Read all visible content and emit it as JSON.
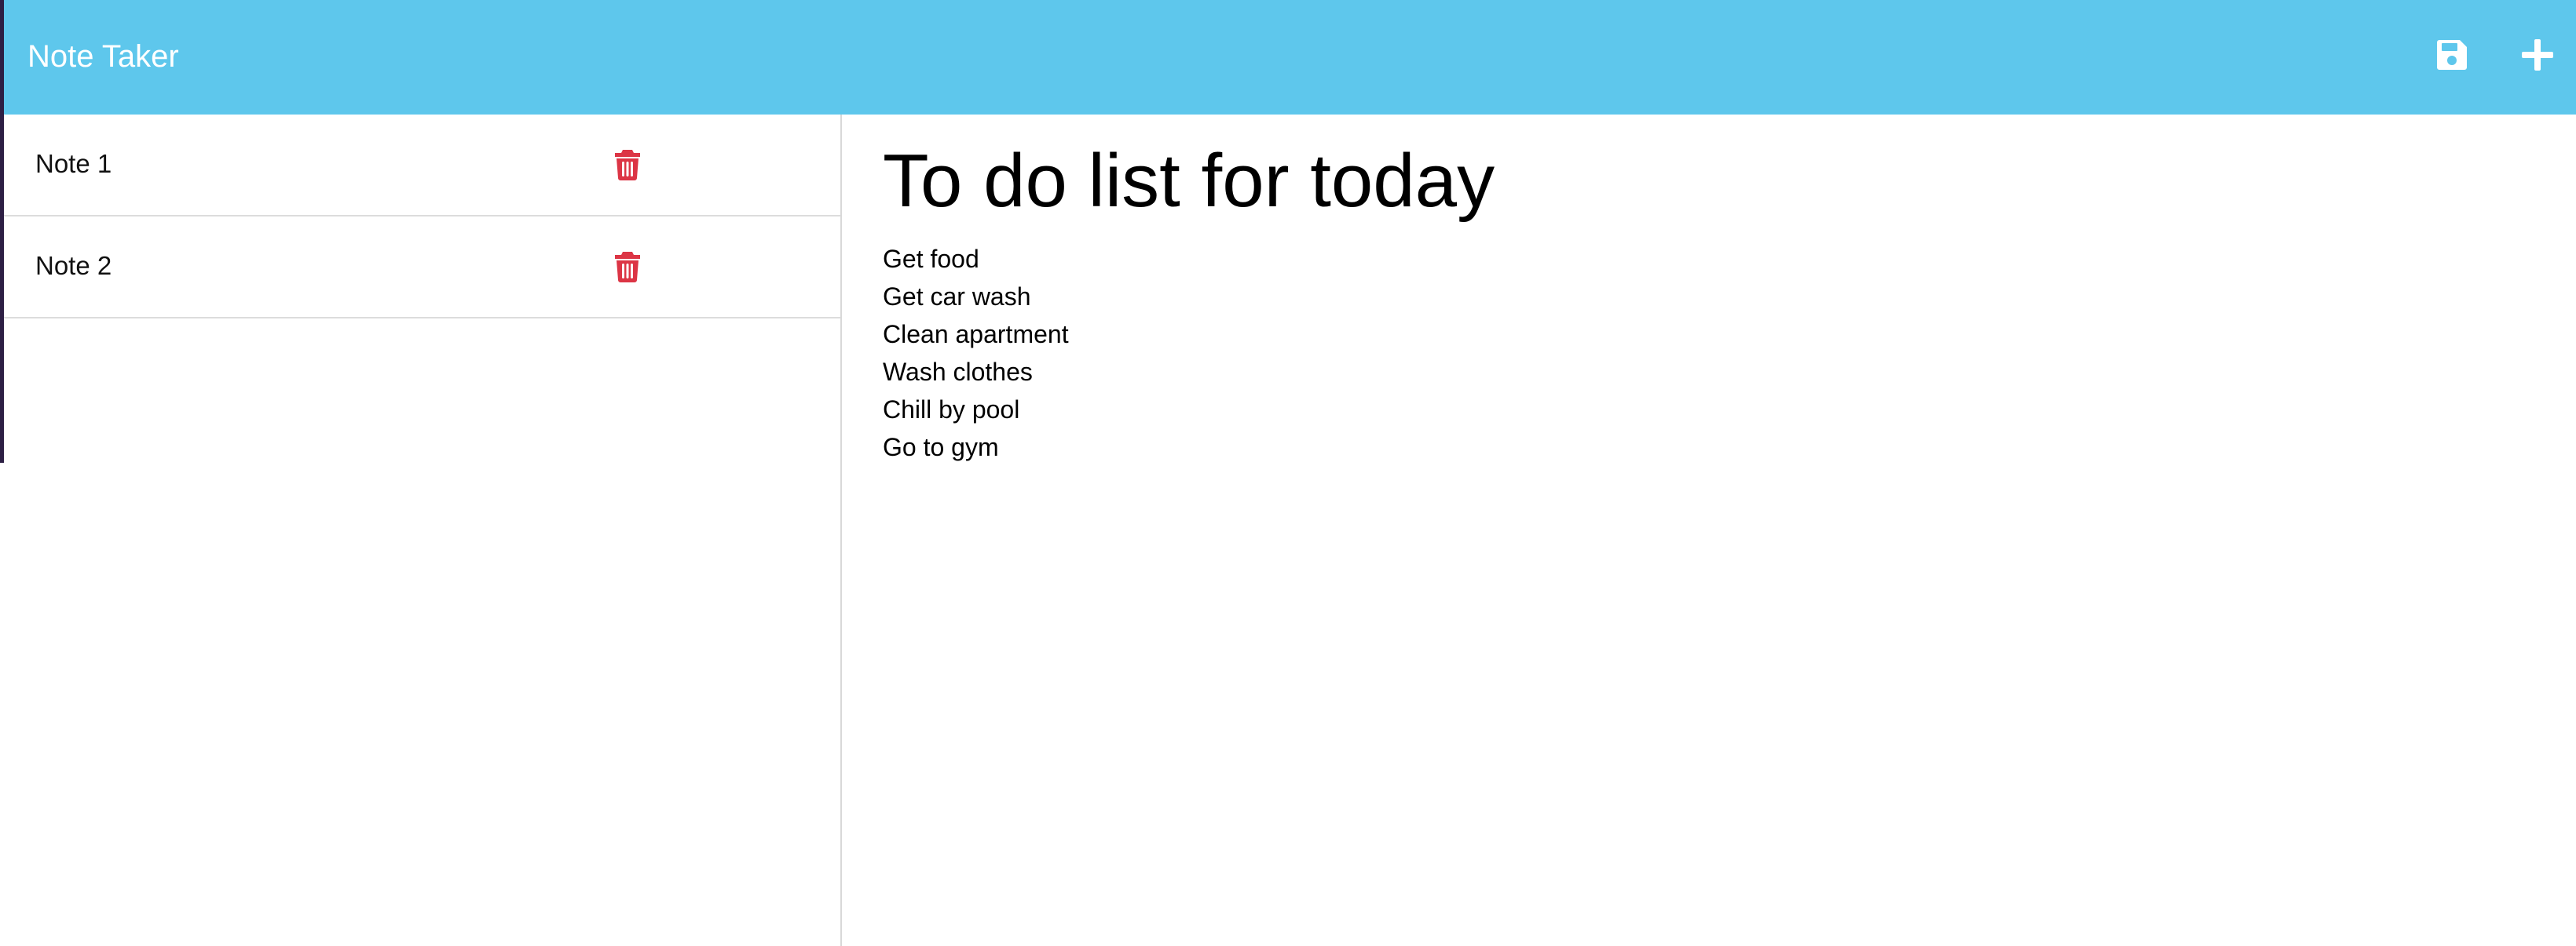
{
  "app": {
    "title": "Note Taker"
  },
  "toolbar": {
    "save_icon": "floppy-disk-icon",
    "new_icon": "plus-icon"
  },
  "colors": {
    "navbar": "#5ec7ec",
    "delete": "#dc3545",
    "text": "#000000"
  },
  "sidebar": {
    "notes": [
      {
        "title": "Note 1",
        "delete_icon": "trash-icon"
      },
      {
        "title": "Note 2",
        "delete_icon": "trash-icon"
      }
    ]
  },
  "editor": {
    "title": "To do list for today",
    "lines": [
      "Get food",
      "Get car wash",
      "Clean apartment",
      "Wash clothes",
      "Chill by pool",
      "Go to gym"
    ]
  }
}
